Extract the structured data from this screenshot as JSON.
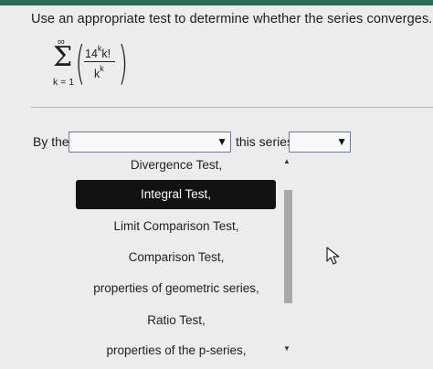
{
  "question": "Use an appropriate test to determine whether the series converges.",
  "series": {
    "sum_upper": "∞",
    "sigma": "Σ",
    "sum_lower": "k = 1",
    "numerator_base": "14",
    "numerator_exp": "k",
    "numerator_rest": "k!",
    "denominator_base": "k",
    "denominator_exp": "k"
  },
  "sentence": {
    "prefix": "By the",
    "middle": "this series"
  },
  "select1": {
    "value": "",
    "arrow": "▼"
  },
  "select2": {
    "value": "",
    "arrow": "▼"
  },
  "dropdown": {
    "options": [
      "Divergence Test,",
      "Integral Test,",
      "Limit Comparison Test,",
      "Comparison Test,",
      "properties of geometric series,",
      "Ratio Test,",
      "properties of the p-series,"
    ],
    "selected_option": "Integral Test,"
  },
  "colors": {
    "accent": "#2c6b57",
    "selected_bg": "#121212",
    "background": "#ececec"
  }
}
